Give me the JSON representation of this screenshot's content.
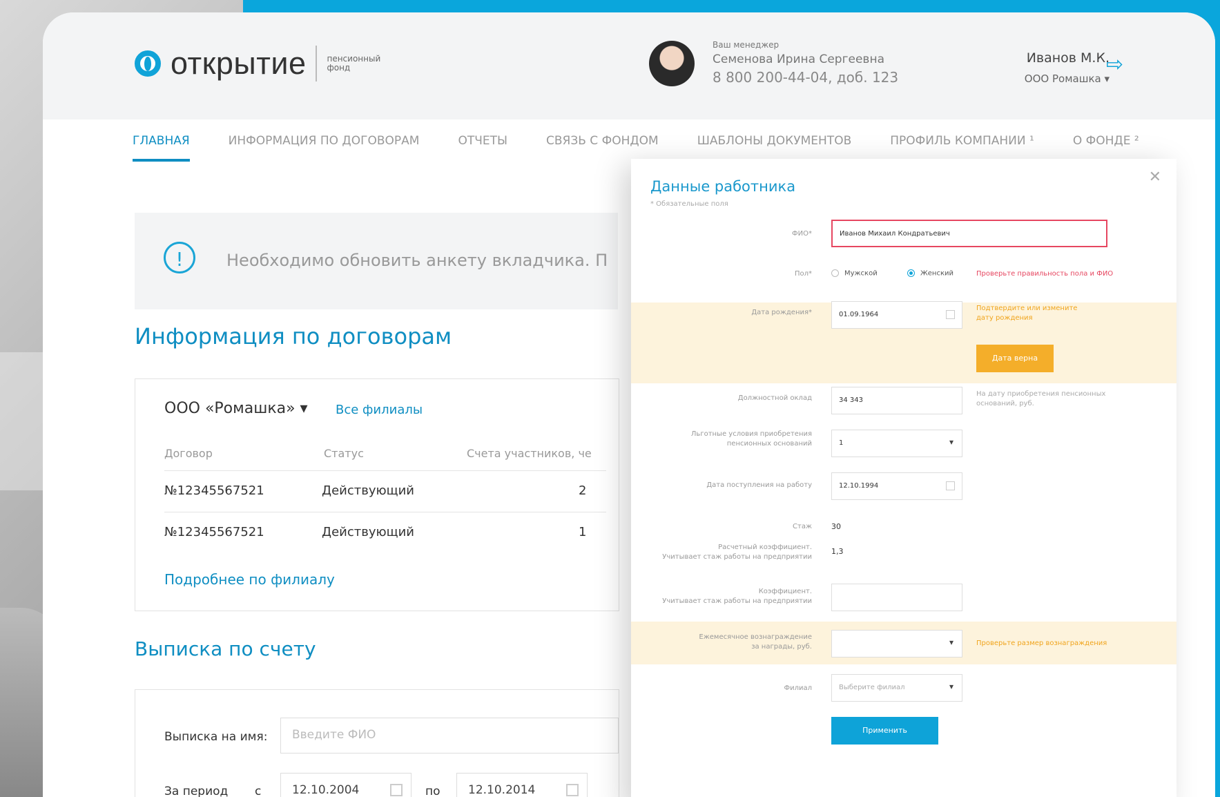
{
  "logo": {
    "name": "открытие",
    "sub_line1": "пенсионный",
    "sub_line2": "фонд"
  },
  "manager": {
    "label": "Ваш менеджер",
    "name": "Семенова Ирина Сергеевна",
    "phone": "8 800 200-44-04, доб. 123"
  },
  "user": {
    "name": "Иванов М.К.",
    "org": "ООО Ромашка ▾"
  },
  "nav": [
    {
      "label": "ГЛАВНАЯ"
    },
    {
      "label": "ИНФОРМАЦИЯ ПО ДОГОВОРАМ"
    },
    {
      "label": "ОТЧЕТЫ"
    },
    {
      "label": "СВЯЗЬ С ФОНДОМ"
    },
    {
      "label": "ШАБЛОНЫ ДОКУМЕНТОВ"
    },
    {
      "label": "ПРОФИЛЬ КОМПАНИИ ¹"
    },
    {
      "label": "О ФОНДЕ ²"
    }
  ],
  "alert": {
    "text": "Необходимо обновить анкету вкладчика. П"
  },
  "contracts": {
    "title": "Информация по договорам",
    "org_select": "ООО «Ромашка» ▾",
    "all_branches": "Все филиалы",
    "columns": [
      "Договор",
      "Статус",
      "Счета участников, че"
    ],
    "rows": [
      {
        "contract": "№12345567521",
        "status": "Действующий",
        "count": "2"
      },
      {
        "contract": "№12345567521",
        "status": "Действующий",
        "count": "1"
      }
    ],
    "more_link": "Подробнее по филиалу"
  },
  "statement": {
    "title": "Выписка по счету",
    "name_label": "Выписка на имя:",
    "name_placeholder": "Введите ФИО",
    "period_label": "За период",
    "from_label": "с",
    "from_value": "12.10.2004",
    "to_label": "по",
    "to_value": "12.10.2014"
  },
  "modal": {
    "title": "Данные работника",
    "required_note": "* Обязательные поля",
    "fio_label": "ФИО*",
    "fio_value": "Иванов Михаил Кондратьевич",
    "gender_label": "Пол*",
    "gender_male": "Мужской",
    "gender_female": "Женский",
    "gender_hint": "Проверьте правильность пола и ФИО",
    "birth_label": "Дата рождения*",
    "birth_value": "01.09.1964",
    "birth_hint_line1": "Подтвердите или измените",
    "birth_hint_line2": "дату рождения",
    "birth_ok_button": "Дата верна",
    "salary_label": "Должностной оклад",
    "salary_value": "34 343",
    "salary_hint_line1": "На дату приобретения пенсионных",
    "salary_hint_line2": "оснований, руб.",
    "benefit_label_line1": "Льготные условия приобретения",
    "benefit_label_line2": "пенсионных оснований",
    "benefit_value": "1",
    "hire_label": "Дата поступления на работу",
    "hire_value": "12.10.1994",
    "exp_label": "Стаж",
    "exp_value": "30",
    "calc_label_line1": "Расчетный коэффициент.",
    "calc_label_line2": "Учитывает стаж работы на предприятии",
    "calc_value": "1,3",
    "coef_label_line1": "Коэффициент.",
    "coef_label_line2": "Учитывает стаж работы на предприятии",
    "bonus_label_line1": "Ежемесячное вознаграждение",
    "bonus_label_line2": "за награды, руб.",
    "bonus_hint": "Проверьте размер вознаграждения",
    "filial_label": "Филиал",
    "filial_placeholder": "Выберите филиал",
    "apply_button": "Применить"
  }
}
